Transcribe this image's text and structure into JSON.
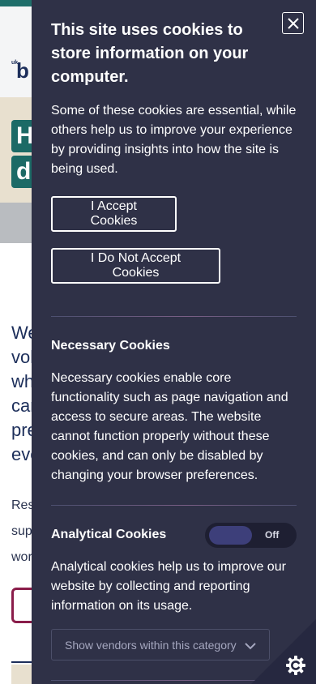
{
  "background": {
    "logo_prefix": "uk",
    "logo_letter": "b",
    "hero_tiles": [
      "H",
      "d"
    ],
    "body_lines": [
      "We",
      "vol",
      "wh",
      "car",
      "pre",
      "eve"
    ],
    "small_lines": [
      "Res",
      "sup",
      "wor"
    ],
    "button_label": ""
  },
  "cookie_panel": {
    "close_label": "Close",
    "title": "This site uses cookies to store information on your computer.",
    "intro": "Some of these cookies are essential, while others help us to improve your experience by providing insights into how the site is being used.",
    "accept_label": "I Accept Cookies",
    "decline_label": "I Do Not Accept Cookies",
    "necessary": {
      "title": "Necessary Cookies",
      "description": "Necessary cookies enable core functionality such as page navigation and access to secure areas. The website cannot function properly without these cookies, and can only be disabled by changing your browser preferences."
    },
    "analytical": {
      "title": "Analytical Cookies",
      "toggle_state": "Off",
      "description": "Analytical cookies help us to improve our website by collecting and reporting information on its usage.",
      "vendors_label": "Show vendors within this category"
    }
  },
  "colors": {
    "panel_bg": "#2f3147",
    "toggle_knob": "#3d3f7a",
    "brand_teal": "#1f6e6a",
    "brand_navy": "#1c2e5a"
  },
  "icons": [
    "close-icon",
    "chevron-down-icon",
    "cookie-settings-icon"
  ]
}
